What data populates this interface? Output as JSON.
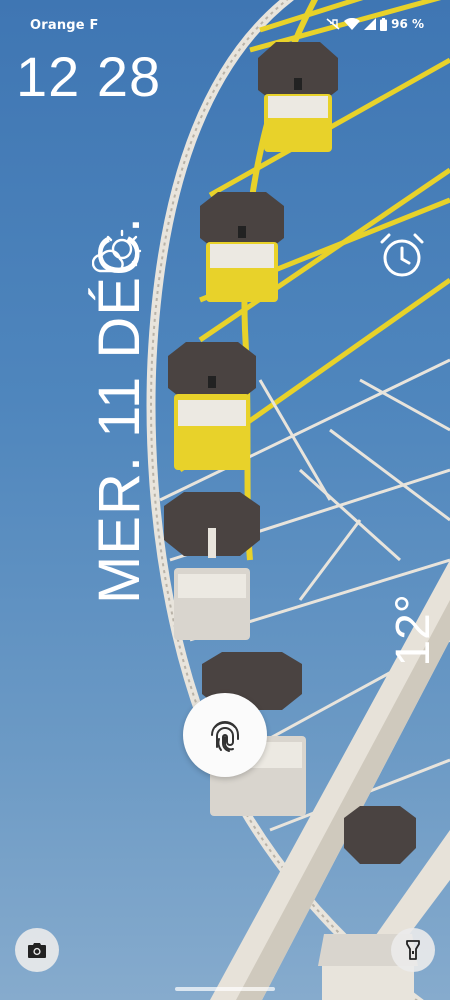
{
  "status_bar": {
    "carrier": "Orange F",
    "battery_percent": "96 %",
    "icons": [
      "mute-icon",
      "wifi-icon",
      "cell-signal-icon",
      "battery-icon"
    ]
  },
  "lock_screen": {
    "time": "12 28",
    "date": "MER. 11 DÉC.",
    "weather_icon": "partly-cloudy-icon",
    "alarm_icon": "alarm-clock-icon",
    "temperature": "12°",
    "fingerprint_icon": "fingerprint-icon"
  },
  "shortcuts": {
    "left": "camera-icon",
    "right": "flashlight-icon"
  },
  "colors": {
    "sky_top": "#3f76b3",
    "sky_bottom": "#86abcd",
    "ferris_yellow": "#e8d22a",
    "ferris_white": "#e8e4dc",
    "gondola_roof": "#4a4341"
  }
}
